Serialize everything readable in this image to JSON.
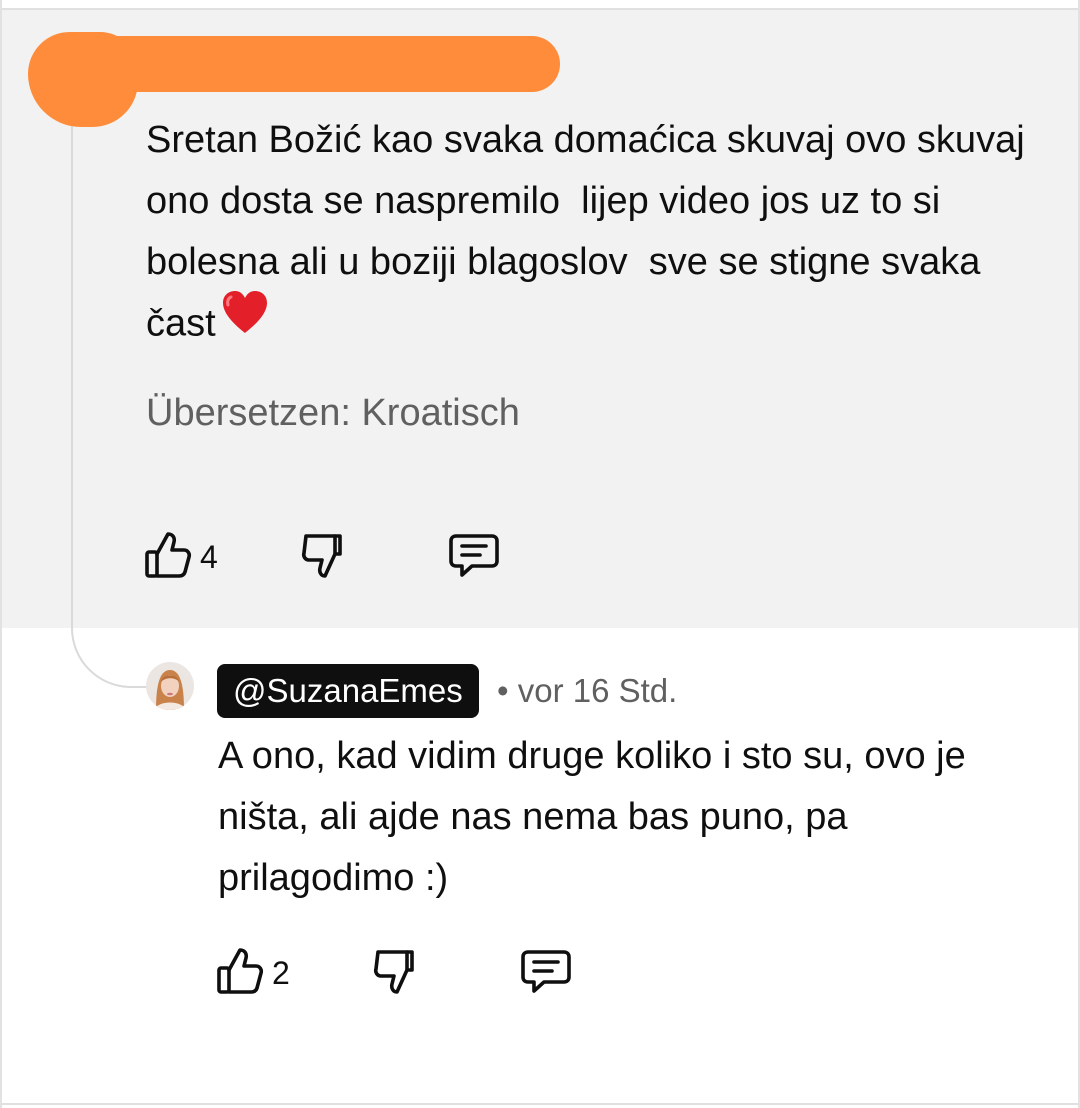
{
  "comment": {
    "text": "Sretan Božić kao svaka domaćica skuvaj ovo skuvaj ono dosta se naspremilo  lijep video jos uz to si bolesna ali u boziji blagoslov  sve se stigne svaka čast",
    "emoji": "heart",
    "translate_label": "Übersetzen: Kroatisch",
    "likes": "4",
    "highlight_color": "#f2f2f2",
    "redaction_color": "#ff8c3a"
  },
  "reply": {
    "handle": "@SuzanaEmes",
    "meta": "• vor 16 Std.",
    "text": "A ono, kad vidim druge koliko i sto su, ovo je ništa, ali ajde nas nema bas puno, pa prilagodimo :)",
    "likes": "2"
  },
  "icons": {
    "like": "thumbs-up-icon",
    "dislike": "thumbs-down-icon",
    "reply": "comment-reply-icon",
    "avatar": "user-avatar",
    "heart": "red-heart-emoji"
  }
}
